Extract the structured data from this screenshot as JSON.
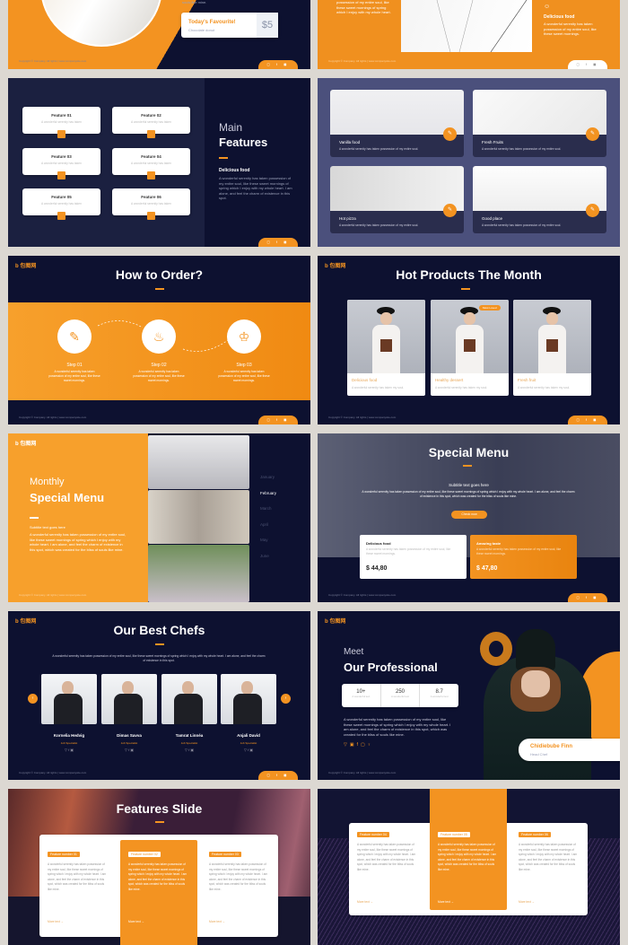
{
  "colors": {
    "accent": "#f39321",
    "navy": "#0d1130",
    "background": "#dcd8d2"
  },
  "footer": {
    "copyright": "Copyright © Company. All rights | www.companysite.com",
    "social_icons": [
      "twitter-icon",
      "facebook-icon",
      "instagram-icon"
    ]
  },
  "logo": "b 包图网",
  "slide_favourite": {
    "text_tail": "souls like mine.",
    "card_title": "Today's Favourite!",
    "card_sub": "Chocolate donut",
    "price": "$5"
  },
  "slide_delicious": {
    "left_text": "possession of my entire soul, like these sweet mornings of spring which I enjoy with my whole heart.",
    "title": "Delicious food",
    "text": "A wonderful serenity has taken possession of my entire soul, like these sweet mornings."
  },
  "slide_main_features": {
    "heading_light": "Main",
    "heading_bold": "Features",
    "sub": "Delicious food",
    "text": "A wonderful serenity has taken possession of my entire soul, like these sweet mornings of spring which I enjoy with my whole heart. I am alone, and feel the charm of existence in this spot.",
    "features": [
      {
        "title": "Feature 01",
        "text": "A wonderful serenity has taken"
      },
      {
        "title": "Feature 02",
        "text": "A wonderful serenity has taken"
      },
      {
        "title": "Feature 03",
        "text": "A wonderful serenity has taken"
      },
      {
        "title": "Feature 04",
        "text": "A wonderful serenity has taken"
      },
      {
        "title": "Feature 05",
        "text": "A wonderful serenity has taken"
      },
      {
        "title": "Feature 06",
        "text": "A wonderful serenity has taken"
      }
    ]
  },
  "slide_foods": {
    "items": [
      {
        "title": "Vanilla food",
        "text": "A wonderful serenity has taken possession of my entire soul."
      },
      {
        "title": "Fresh Fruits",
        "text": "A wonderful serenity has taken possession of my entire soul."
      },
      {
        "title": "Hot pizza",
        "text": "A wonderful serenity has taken possession of my entire soul."
      },
      {
        "title": "Good place",
        "text": "A wonderful serenity has taken possession of my entire soul."
      }
    ]
  },
  "slide_order": {
    "title": "How to Order?",
    "steps": [
      {
        "label": "Step 01",
        "text": "A wonderful serenity has taken possession of my entire soul, like these sweet mornings."
      },
      {
        "label": "Step 02",
        "text": "A wonderful serenity has taken possession of my entire soul, like these sweet mornings."
      },
      {
        "label": "Step 03",
        "text": "A wonderful serenity has taken possession of my entire soul, like these sweet mornings."
      }
    ]
  },
  "slide_hot": {
    "title": "Hot Products The Month",
    "badge": "Most Loved",
    "products": [
      {
        "name": "Delicious food",
        "text": "A wonderful serenity has taken my soul."
      },
      {
        "name": "Healthy dessert",
        "text": "A wonderful serenity has taken my soul."
      },
      {
        "name": "Fresh fruit",
        "text": "A wonderful serenity has taken my soul."
      }
    ]
  },
  "slide_monthly": {
    "heading_light": "Monthly",
    "heading_bold": "Special Menu",
    "sub": "Subtitle text goes here",
    "text": "A wonderful serenity has taken possession of my entire soul, like these sweet mornings of spring which I enjoy with my whole heart. I am alone, and feel the charm of existence in this spot, which was created for the bliss of souls like mine.",
    "months": [
      "January",
      "February",
      "March",
      "April",
      "May",
      "June"
    ],
    "active_month": "February"
  },
  "slide_special": {
    "title": "Special Menu",
    "sub": "Subtitle text goes here",
    "text": "A wonderful serenity has taken possession of my entire soul, like these sweet mornings of spring which I enjoy with my whole heart. I am alone, and feel the charm of existence in this spot, which was created for the bliss of souls like mine.",
    "button": "Check now",
    "cards": [
      {
        "title": "Delicious food",
        "text": "A wonderful serenity has taken possession of my entire soul, like these sweet mornings.",
        "price": "$ 44,80"
      },
      {
        "title": "Amazing taste",
        "text": "A wonderful serenity has taken possession of my entire soul, like these sweet mornings.",
        "price": "$ 47,80"
      }
    ]
  },
  "slide_chefs": {
    "title": "Our Best Chefs",
    "text": "A wonderful serenity has taken possession of my entire soul, like these sweet mornings of spring which I enjoy with my whole heart. I am alone, and feel the charm of existence in this spot.",
    "chefs": [
      {
        "name": "Kornelia Hedvig",
        "role": "Job Specialist"
      },
      {
        "name": "Dimas Savva",
        "role": "Job Specialist"
      },
      {
        "name": "Tamrat Linnéa",
        "role": "Job Specialist"
      },
      {
        "name": "Anjali David",
        "role": "Job Specialist"
      }
    ]
  },
  "slide_professional": {
    "heading_light": "Meet",
    "heading_bold": "Our Professional",
    "stats": [
      {
        "value": "10+",
        "label": "A wonderful text"
      },
      {
        "value": "250",
        "label": "A wonderful text"
      },
      {
        "value": "8.7",
        "label": "A wonderful text"
      }
    ],
    "text": "A wonderful serenity has taken possession of my entire soul, like these sweet mornings of spring which I enjoy with my whole heart. I am alone, and feel the charm of existence in this spot, which was created for the bliss of souls like mine.",
    "name": "Chidiebube Finn",
    "role": "Head Chef"
  },
  "slide_features": {
    "title": "Features Slide",
    "more": "More text",
    "items": [
      {
        "label": "Feature number 01",
        "text": "A wonderful serenity has taken possession of my entire soul, like these sweet mornings of spring which I enjoy with my whole heart. I am alone, and feel the charm of existence in this spot, which was created for the bliss of souls like mine."
      },
      {
        "label": "Feature number 02",
        "text": "A wonderful serenity has taken possession of my entire soul, like these sweet mornings of spring which I enjoy with my whole heart. I am alone, and feel the charm of existence in this spot, which was created for the bliss of souls like mine."
      },
      {
        "label": "Feature number 03",
        "text": "A wonderful serenity has taken possession of my entire soul, like these sweet mornings of spring which I enjoy with my whole heart. I am alone, and feel the charm of existence in this spot, which was created for the bliss of souls like mine."
      }
    ]
  },
  "slide_features2": {
    "more": "More text",
    "items": [
      {
        "label": "Feature number 04",
        "text": "A wonderful serenity has taken possession of my entire soul, like these sweet mornings of spring which I enjoy with my whole heart. I am alone, and feel the charm of existence in this spot, which was created for the bliss of souls like mine."
      },
      {
        "label": "Feature number 05",
        "text": "A wonderful serenity has taken possession of my entire soul, like these sweet mornings of spring which I enjoy with my whole heart. I am alone, and feel the charm of existence in this spot, which was created for the bliss of souls like mine."
      },
      {
        "label": "Feature number 06",
        "text": "A wonderful serenity has taken possession of my entire soul, like these sweet mornings of spring which I enjoy with my whole heart. I am alone, and feel the charm of existence in this spot, which was created for the bliss of souls like mine."
      }
    ]
  }
}
